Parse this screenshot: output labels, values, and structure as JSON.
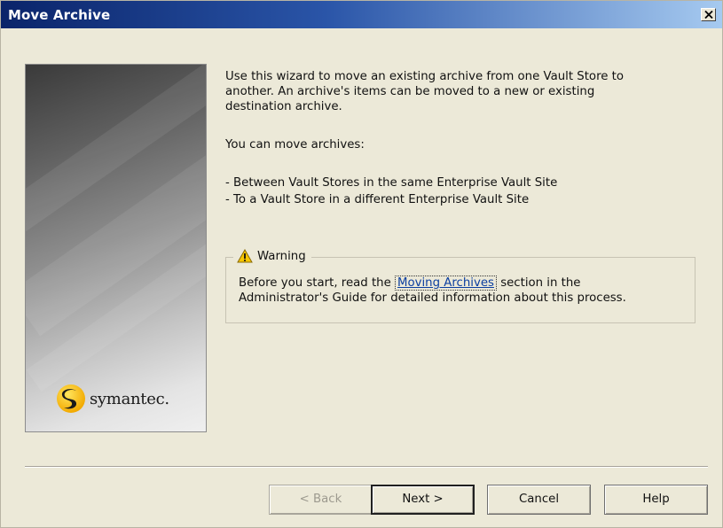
{
  "window": {
    "title": "Move Archive",
    "close_glyph": "✕"
  },
  "side_panel": {
    "logo_text": "symantec."
  },
  "intro": {
    "line1": "Use this wizard to move an existing archive from one Vault Store to",
    "line2": "another. An archive's items can be moved to a new or existing",
    "line3": "destination archive."
  },
  "move_heading": "You can move archives:",
  "bullets": [
    "-  Between Vault Stores in the same Enterprise Vault Site",
    "-  To a Vault Store in a different Enterprise Vault Site"
  ],
  "warning": {
    "label": "Warning",
    "text_before_link": "Before you start, read the ",
    "link_text": "Moving Archives",
    "text_after_link": " section in the",
    "line2": "Administrator's Guide for detailed information about this process."
  },
  "buttons": {
    "back": "< Back",
    "next": "Next >",
    "cancel": "Cancel",
    "help": "Help"
  },
  "colors": {
    "title_gradient_start": "#0a246a",
    "title_gradient_end": "#a6caf0",
    "dialog_bg": "#ece9d8",
    "link": "#0b3ea0",
    "warning_icon": "#f7c600"
  },
  "icons": [
    "close-icon",
    "warning-icon",
    "symantec-logo-icon"
  ]
}
